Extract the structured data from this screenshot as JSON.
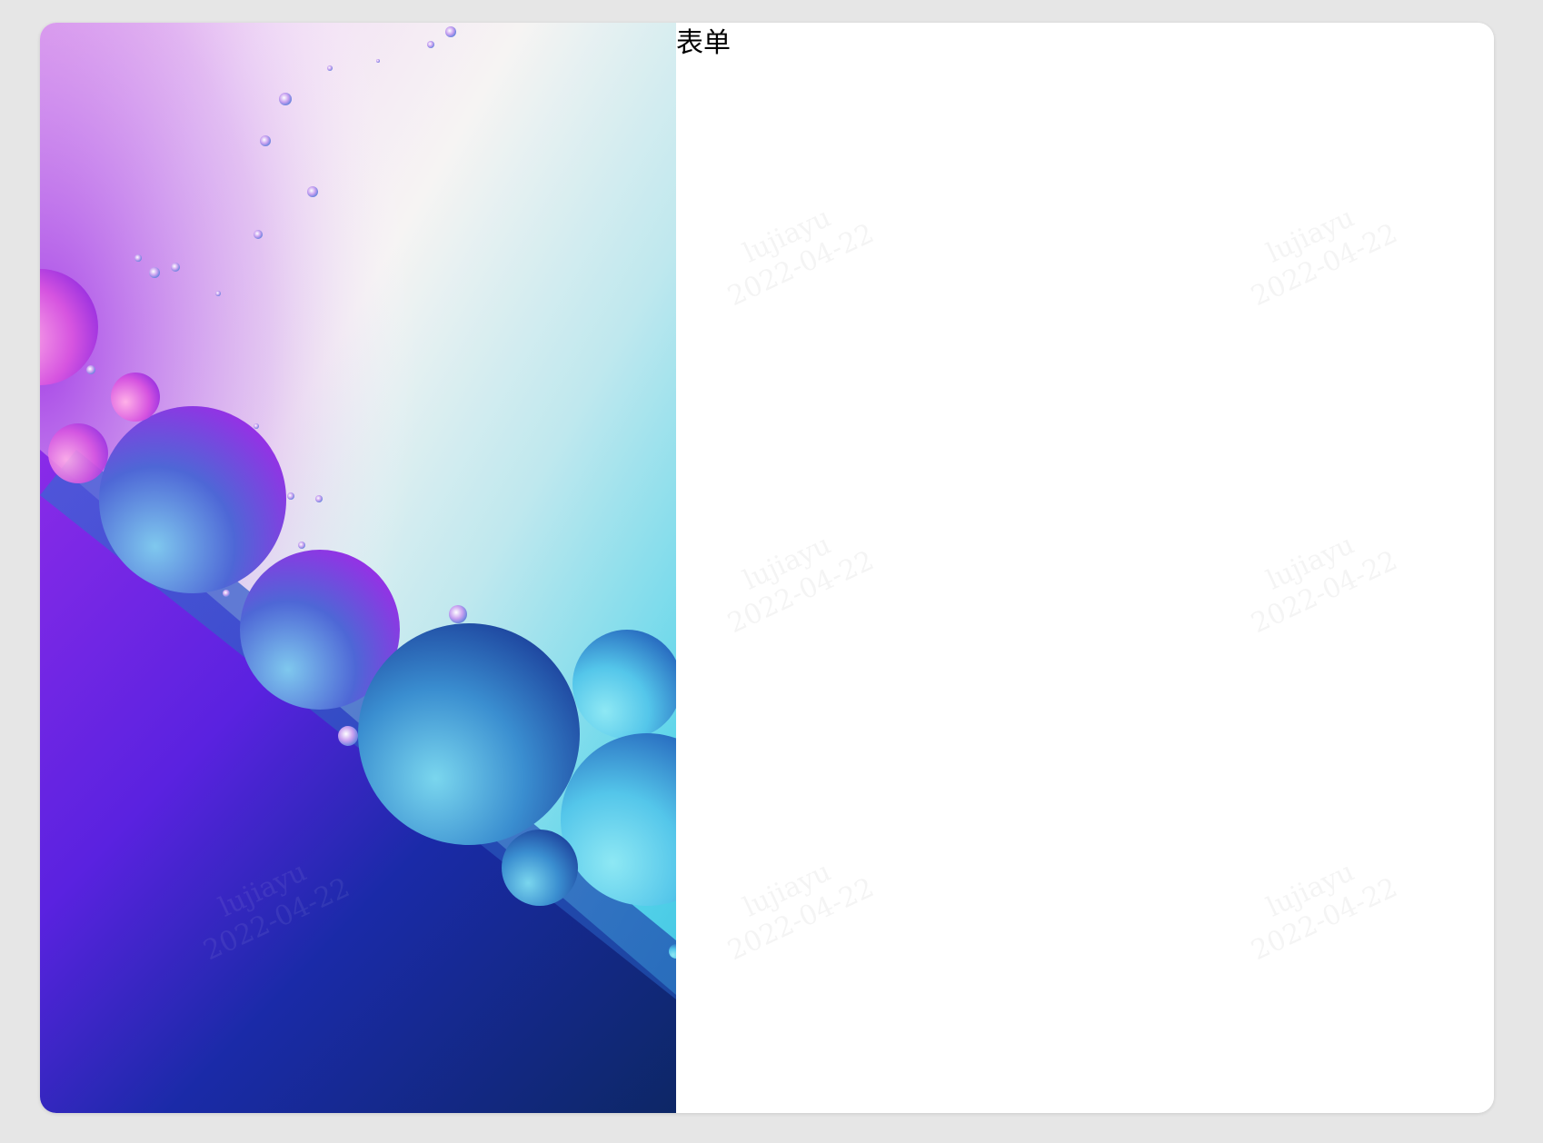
{
  "form": {
    "title": "表单"
  },
  "hero_image": {
    "description_icon": "bubbles-wallpaper-image",
    "colors": {
      "top_right": "#fbf4ef",
      "top_left": "#eec0f2",
      "violet": "#7a28e8",
      "cyan": "#5fd8ea",
      "navy": "#0d2766",
      "magenta": "#d04fe0"
    }
  },
  "watermark": {
    "user": "lujiayu",
    "date": "2022-04-22"
  }
}
